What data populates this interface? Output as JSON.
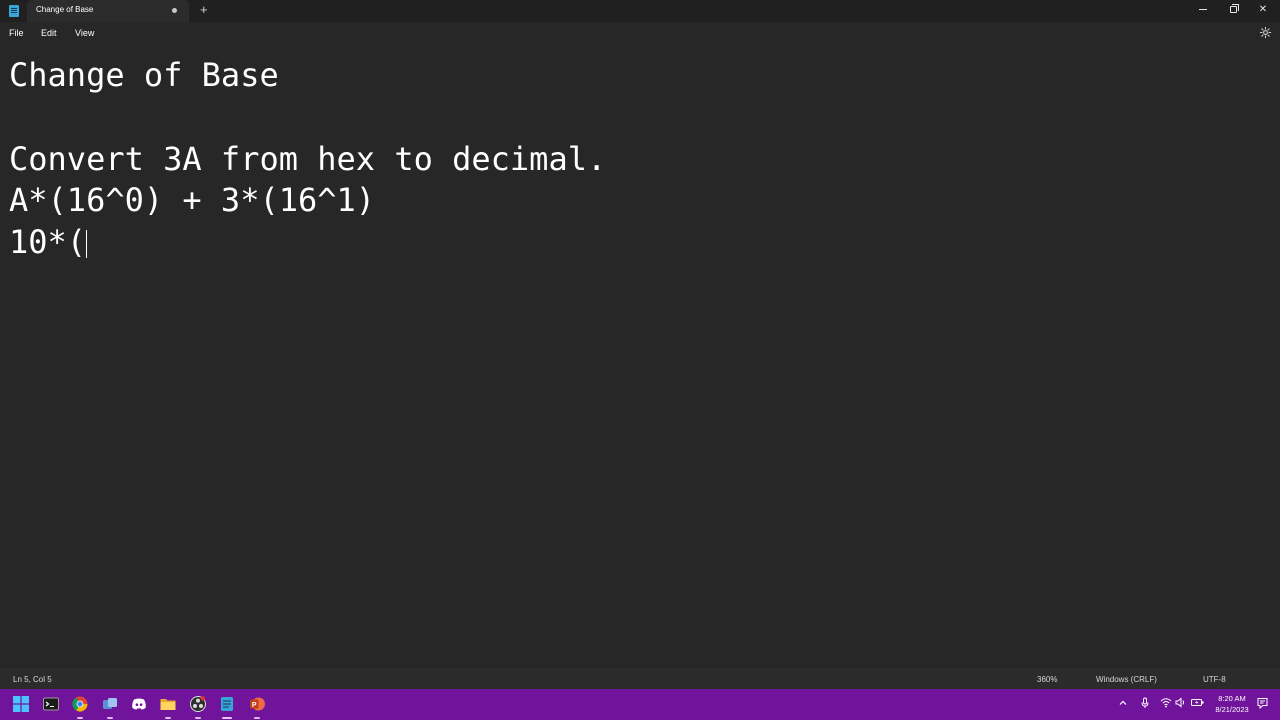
{
  "window": {
    "tab_title": "Change of Base",
    "new_tab_label": "+"
  },
  "menu": {
    "file": "File",
    "edit": "Edit",
    "view": "View"
  },
  "document": {
    "lines": [
      "Change of Base",
      "",
      "Convert 3A from hex to decimal.",
      "A*(16^0) + 3*(16^1)",
      "10*("
    ]
  },
  "status": {
    "position": "Ln 5, Col 5",
    "zoom": "360%",
    "line_ending": "Windows (CRLF)",
    "encoding": "UTF-8"
  },
  "taskbar": {
    "time": "8:20 AM",
    "date": "8/21/2023",
    "pinned": [
      "windows-start-icon",
      "terminal-icon",
      "chrome-icon",
      "app-icon",
      "discord-icon",
      "file-explorer-icon",
      "obs-icon",
      "notepad-icon",
      "powerpoint-icon"
    ]
  },
  "colors": {
    "editor_bg": "#272727",
    "text": "#ffffff",
    "taskbar_bg": "#70149b"
  }
}
